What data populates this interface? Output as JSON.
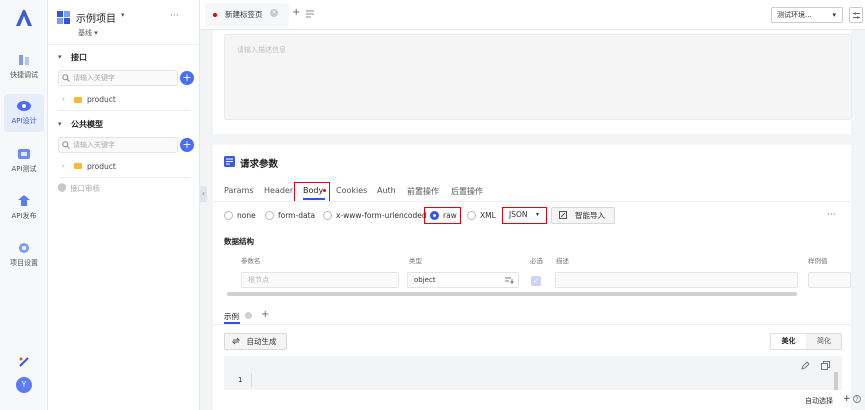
{
  "rail": {
    "items": [
      {
        "label": "快捷调试",
        "icon": "bolt-icon"
      },
      {
        "label": "API设计",
        "icon": "api-design-icon"
      },
      {
        "label": "API测试",
        "icon": "api-test-icon"
      },
      {
        "label": "API发布",
        "icon": "publish-icon"
      },
      {
        "label": "项目设置",
        "icon": "settings-icon"
      }
    ],
    "avatar": "Y"
  },
  "sidebar": {
    "project_name": "示例项目",
    "baseline": "基线",
    "more": "···",
    "sections": [
      {
        "title": "接口",
        "search_placeholder": "请输入关键字",
        "folder": "product"
      },
      {
        "title": "公共模型",
        "search_placeholder": "请输入关键字",
        "folder": "product"
      }
    ],
    "audit": "接口审核"
  },
  "topbar": {
    "tab_label": "新建标签页",
    "add": "+",
    "env_label": "测试环境...",
    "env_arrow": "▾"
  },
  "description": {
    "placeholder": "请输入描述信息"
  },
  "request": {
    "title": "请求参数",
    "tabs": [
      "Params",
      "Header",
      "Body",
      "Cookies",
      "Auth",
      "前置操作",
      "后置操作"
    ],
    "active_tab": "Body",
    "body_types": [
      "none",
      "form-data",
      "x-www-form-urlencoded",
      "raw",
      "XML"
    ],
    "selected_type": "raw",
    "format": "JSON",
    "smart_import": "智能导入",
    "more": "···"
  },
  "structure": {
    "title": "数据结构",
    "headers": [
      "参数名",
      "类型",
      "必选",
      "描述",
      "样例值"
    ],
    "row": {
      "name_placeholder": "根节点",
      "type": "object"
    }
  },
  "example": {
    "tab": "示例",
    "add": "+",
    "autogen": "自动生成",
    "beautify": "美化",
    "simplify": "简化",
    "line_number": "1"
  },
  "footer": {
    "auto_select": "自动选择"
  }
}
